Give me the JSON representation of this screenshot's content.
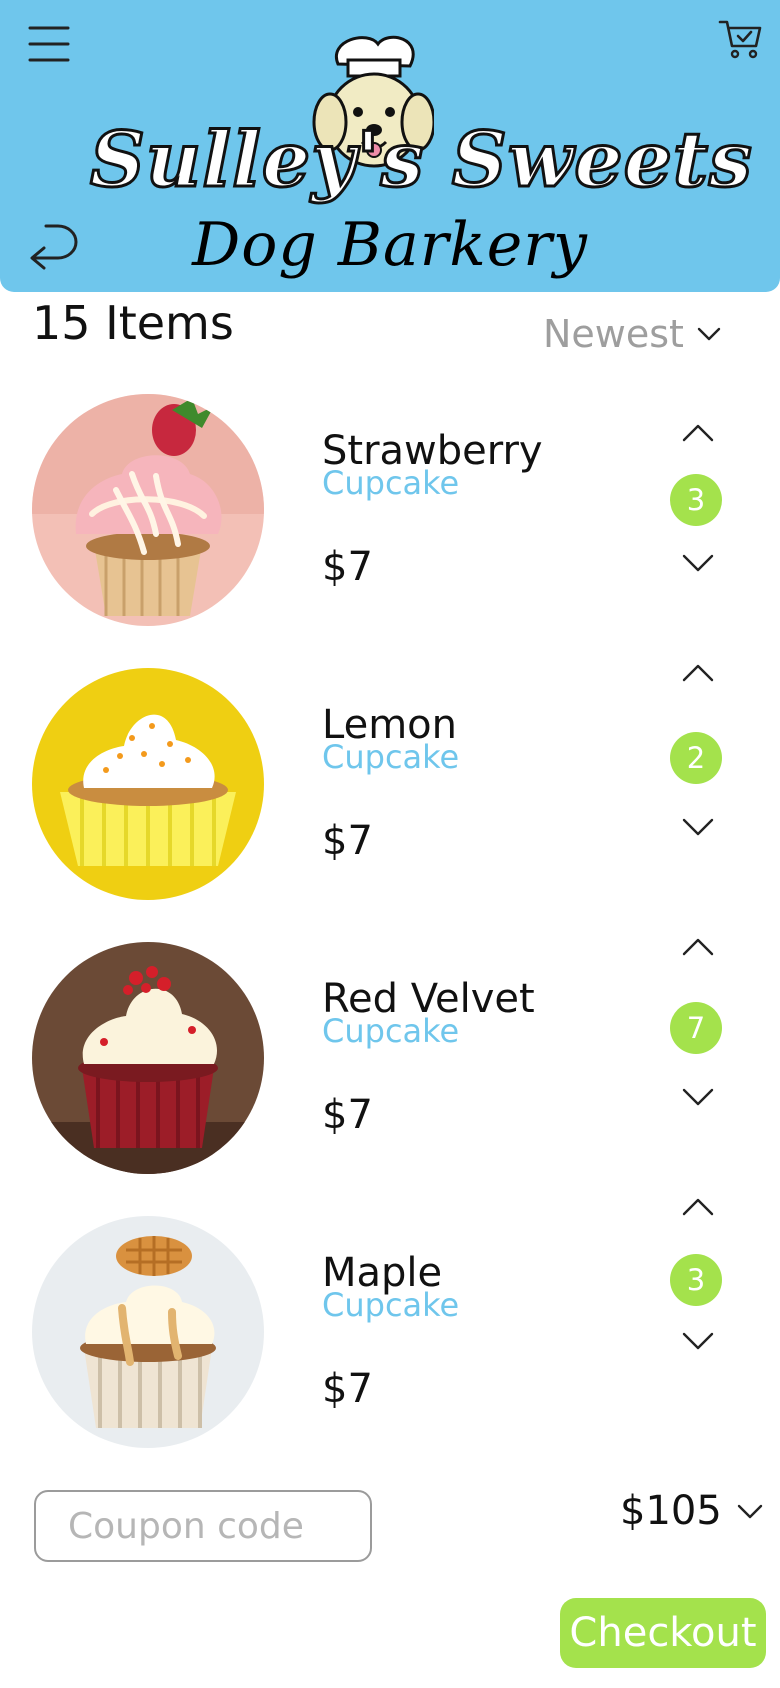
{
  "header": {
    "brand_title": "Sulley's Sweets",
    "brand_subtitle": "Dog Barkery",
    "menu_icon": "hamburger-menu-icon",
    "cart_icon": "shopping-cart-icon",
    "back_icon": "back-arrow-icon",
    "background": "#6fc6ec"
  },
  "toolbar": {
    "items_count": "15 Items",
    "sort_label": "Newest"
  },
  "items": [
    {
      "name": "Strawberry",
      "type": "Cupcake",
      "price": "$7",
      "qty": "3"
    },
    {
      "name": "Lemon",
      "type": "Cupcake",
      "price": "$7",
      "qty": "2"
    },
    {
      "name": "Red Velvet",
      "type": "Cupcake",
      "price": "$7",
      "qty": "7"
    },
    {
      "name": "Maple",
      "type": "Cupcake",
      "price": "$7",
      "qty": "3"
    }
  ],
  "footer": {
    "coupon_placeholder": "Coupon code",
    "total": "$105",
    "checkout_label": "Checkout"
  },
  "colors": {
    "accent_blue": "#6fc6ec",
    "accent_green": "#a4e24c"
  }
}
